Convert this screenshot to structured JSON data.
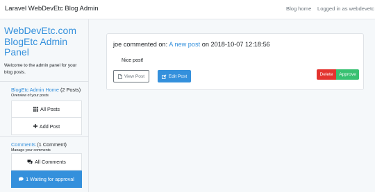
{
  "navbar": {
    "brand": "Laravel WebDevEtc Blog Admin",
    "blog_home": "Blog home",
    "logged_in": "Logged in as webdevetc"
  },
  "sidebar": {
    "title": "WebDevEtc.com BlogEtc Admin Panel",
    "welcome": "Welcome to the admin panel for your blog posts.",
    "posts_section": {
      "heading_link": "BlogEtc Admin Home",
      "heading_count": "(2 Posts)",
      "subtitle": "Overview of your posts",
      "items": [
        {
          "label": "All Posts",
          "icon": "th-icon"
        },
        {
          "label": "Add Post",
          "icon": "plus-icon"
        }
      ]
    },
    "comments_section": {
      "heading_link": "Comments",
      "heading_count": "(1 Comment)",
      "subtitle": "Manage your comments",
      "items": [
        {
          "label": "All Comments",
          "icon": "comments-icon"
        },
        {
          "label": "1 Waiting for approval",
          "icon": "comment-icon"
        }
      ]
    }
  },
  "comment": {
    "author_text": "joe commented on:",
    "post_link": "A new post",
    "date_text": "on 2018-10-07 12:18:56",
    "body": "Nice post!",
    "view_label": "View Post",
    "edit_label": "Edit Post",
    "delete_label": "Delete",
    "approve_label": "Approve"
  },
  "colors": {
    "accent": "#3490dc",
    "danger": "#e3342f",
    "success": "#38c172"
  }
}
